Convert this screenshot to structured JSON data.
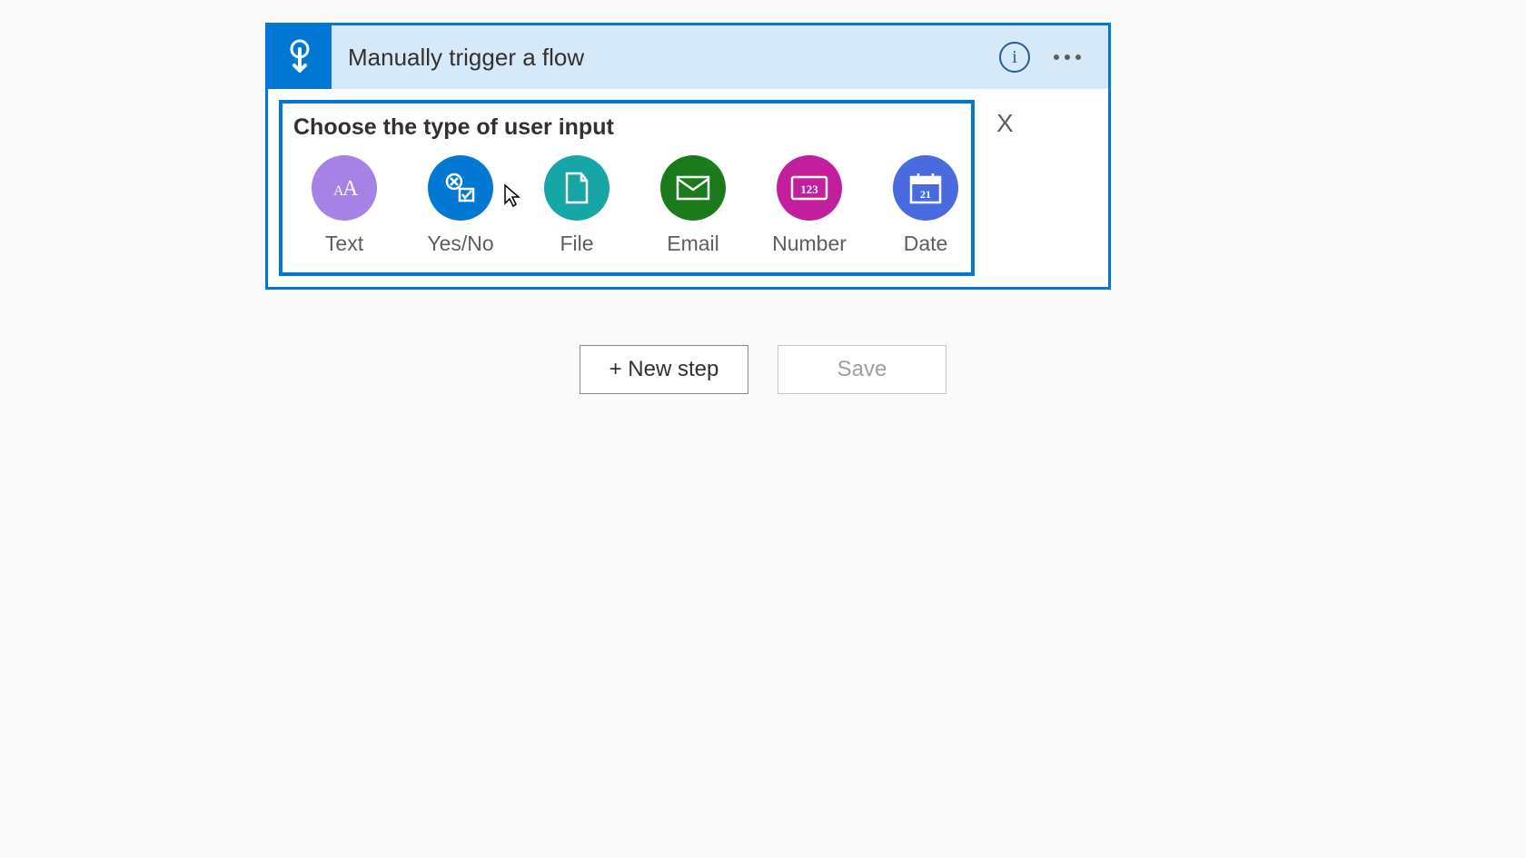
{
  "trigger": {
    "title": "Manually trigger a flow",
    "info_label": "i",
    "close_label": "X"
  },
  "input_panel": {
    "heading": "Choose the type of user input",
    "options": [
      {
        "key": "text",
        "label": "Text",
        "icon": "text-icon"
      },
      {
        "key": "yesno",
        "label": "Yes/No",
        "icon": "yesno-icon"
      },
      {
        "key": "file",
        "label": "File",
        "icon": "file-icon"
      },
      {
        "key": "email",
        "label": "Email",
        "icon": "email-icon"
      },
      {
        "key": "number",
        "label": "Number",
        "icon": "number-icon"
      },
      {
        "key": "date",
        "label": "Date",
        "icon": "date-icon"
      }
    ]
  },
  "icons": {
    "number_value": "123",
    "date_value": "21"
  },
  "actions": {
    "new_step": "+ New step",
    "save": "Save"
  }
}
